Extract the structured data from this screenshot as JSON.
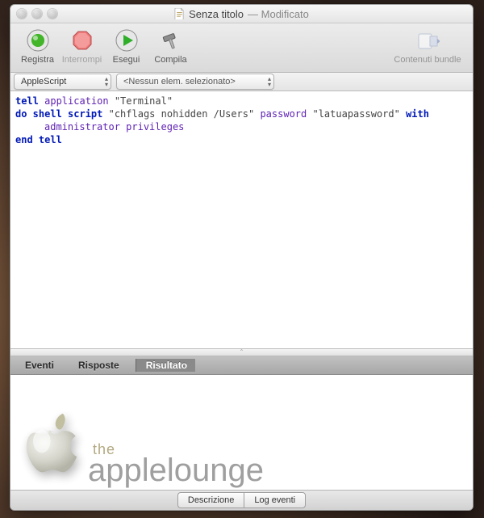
{
  "window": {
    "title": "Senza titolo",
    "modified": "— Modificato"
  },
  "toolbar": {
    "record": "Registra",
    "stop": "Interrompi",
    "run": "Esegui",
    "compile": "Compila",
    "bundle": "Contenuti bundle"
  },
  "subbar": {
    "language": "AppleScript",
    "element": "<Nessun elem. selezionato>"
  },
  "script": {
    "line1a": "tell",
    "line1b": " application",
    "line1c": " \"Terminal\"",
    "line2a": "do shell script",
    "line2b": " \"chflags nohidden /Users\" ",
    "line2c": "password",
    "line2d": " \"latuapassword\" ",
    "line2e": "with",
    "line3": "administrator privileges",
    "line4": "end tell"
  },
  "tabs": {
    "events": "Eventi",
    "replies": "Risposte",
    "result": "Risultato"
  },
  "statusbar": {
    "description": "Descrizione",
    "eventlog": "Log eventi"
  },
  "watermark": {
    "small": "the",
    "big": "applelounge"
  }
}
